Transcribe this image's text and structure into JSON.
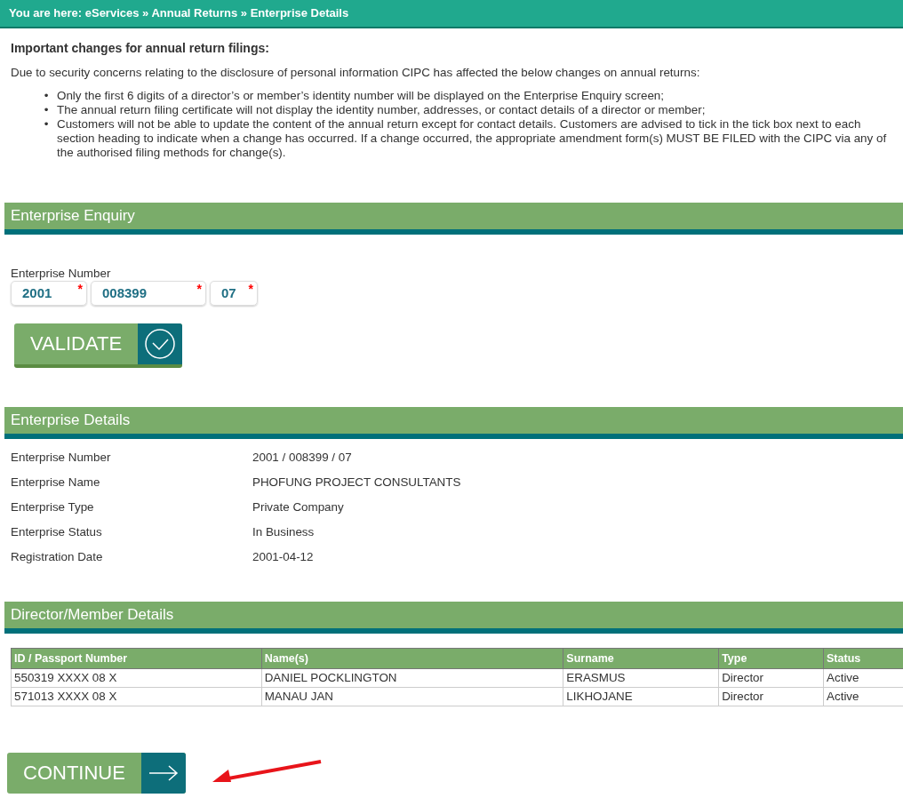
{
  "breadcrumb": "You are here: eServices » Annual Returns » Enterprise Details",
  "notice": {
    "title": "Important changes for annual return filings:",
    "intro": "Due to security concerns relating to the disclosure of personal information CIPC has affected the below changes on annual returns:",
    "bullet": "•",
    "items": [
      "Only the first 6 digits of a director’s or member’s identity number will be displayed on the Enterprise Enquiry screen;",
      "The annual return filing certificate will not display the identity number, addresses, or contact details of a director or member;",
      "Customers will not be able to update the content of the annual return except for contact details. Customers are advised to tick in the tick box next to each section heading to indicate when a change has occurred. If a change occurred, the appropriate amendment form(s) MUST BE FILED with the CIPC via any of the authorised filing methods for change(s)."
    ]
  },
  "enquiry": {
    "title": "Enterprise Enquiry",
    "label": "Enterprise Number",
    "required_mark": "*",
    "fields": [
      {
        "value": "2001",
        "required": true
      },
      {
        "value": "008399",
        "required": true
      },
      {
        "value": "07",
        "required": true
      }
    ],
    "button": "VALIDATE"
  },
  "details": {
    "title": "Enterprise Details",
    "rows": [
      {
        "label": "Enterprise Number",
        "value": "2001 / 008399 / 07"
      },
      {
        "label": "Enterprise Name",
        "value": "PHOFUNG PROJECT CONSULTANTS"
      },
      {
        "label": "Enterprise Type",
        "value": "Private Company"
      },
      {
        "label": "Enterprise Status",
        "value": "In Business"
      },
      {
        "label": "Registration Date",
        "value": "2001-04-12"
      }
    ]
  },
  "directors": {
    "title": "Director/Member Details",
    "columns": [
      "ID / Passport Number",
      "Name(s)",
      "Surname",
      "Type",
      "Status"
    ],
    "rows": [
      [
        "550319 XXXX 08 X",
        "DANIEL POCKLINGTON",
        "ERASMUS",
        "Director",
        "Active"
      ],
      [
        "571013 XXXX 08 X",
        "MANAU JAN",
        "LIKHOJANE",
        "Director",
        "Active"
      ]
    ]
  },
  "continue_button": "CONTINUE"
}
